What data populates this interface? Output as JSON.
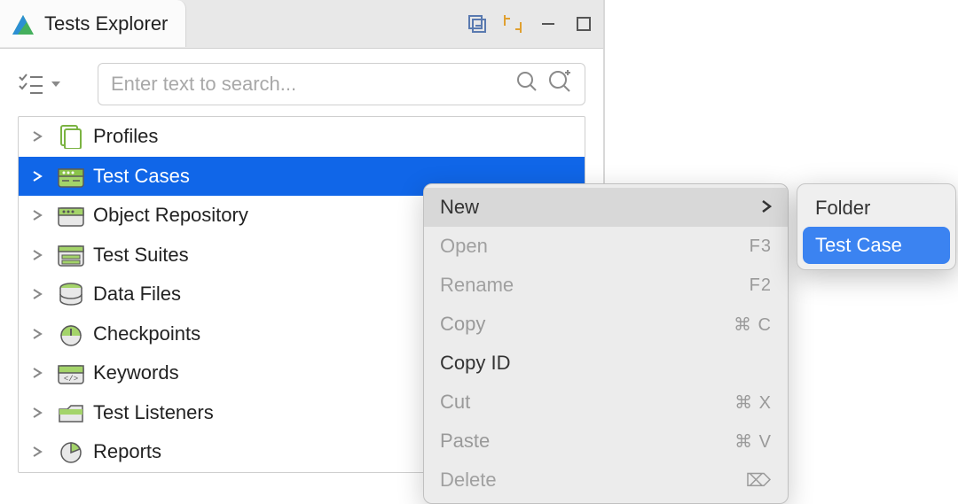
{
  "tab": {
    "title": "Tests Explorer"
  },
  "search": {
    "placeholder": "Enter text to search..."
  },
  "tree": {
    "items": [
      {
        "label": "Profiles",
        "icon": "profiles-icon",
        "iconColor": "#7bb342"
      },
      {
        "label": "Test Cases",
        "icon": "testcases-icon",
        "iconColor": "#7bb342"
      },
      {
        "label": "Object Repository",
        "icon": "objectrepo-icon",
        "iconColor": "#7bb342"
      },
      {
        "label": "Test Suites",
        "icon": "testsuites-icon",
        "iconColor": "#7bb342"
      },
      {
        "label": "Data Files",
        "icon": "datafiles-icon",
        "iconColor": "#7bb342"
      },
      {
        "label": "Checkpoints",
        "icon": "checkpoints-icon",
        "iconColor": "#7bb342"
      },
      {
        "label": "Keywords",
        "icon": "keywords-icon",
        "iconColor": "#7bb342"
      },
      {
        "label": "Test Listeners",
        "icon": "listeners-icon",
        "iconColor": "#7bb342"
      },
      {
        "label": "Reports",
        "icon": "reports-icon",
        "iconColor": "#7bb342"
      }
    ],
    "selectedIndex": 1
  },
  "contextMenu": {
    "items": [
      {
        "label": "New",
        "state": "highlighted",
        "hasSubmenu": true
      },
      {
        "label": "Open",
        "state": "disabled",
        "shortcut": "F3"
      },
      {
        "label": "Rename",
        "state": "disabled",
        "shortcut": "F2"
      },
      {
        "label": "Copy",
        "state": "halfdisabled",
        "shortcut": "⌘ C"
      },
      {
        "label": "Copy ID",
        "state": "normal"
      },
      {
        "label": "Cut",
        "state": "halfdisabled",
        "shortcut": "⌘ X"
      },
      {
        "label": "Paste",
        "state": "halfdisabled",
        "shortcut": "⌘ V"
      },
      {
        "label": "Delete",
        "state": "disabled",
        "shortcut": "⌦"
      }
    ]
  },
  "submenu": {
    "items": [
      {
        "label": "Folder"
      },
      {
        "label": "Test Case"
      }
    ],
    "selectedIndex": 1
  }
}
